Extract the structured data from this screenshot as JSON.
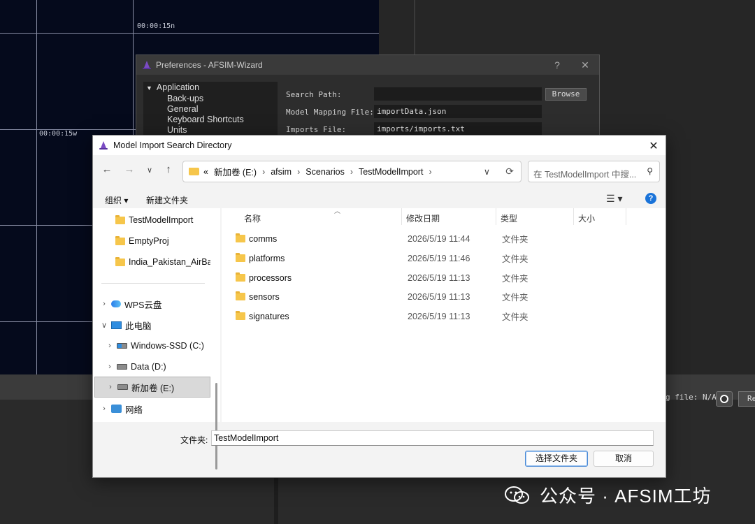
{
  "background": {
    "timestamps": [
      "00:00:15n",
      "00:00:15w"
    ],
    "log_label": "g file: N/A",
    "re_button": "Re"
  },
  "preferences": {
    "title": "Preferences - AFSIM-Wizard",
    "help": "?",
    "close": "✕",
    "tree": {
      "root": "Application",
      "children": [
        "Back-ups",
        "General",
        "Keyboard Shortcuts",
        "Units"
      ]
    },
    "fields": [
      {
        "label": "Search Path:",
        "value": ""
      },
      {
        "label": "Model Mapping File:",
        "value": "importData.json"
      },
      {
        "label": "Imports File:",
        "value": "imports/imports.txt"
      }
    ],
    "browse_label": "Browse"
  },
  "dialog": {
    "title": "Model Import Search Directory",
    "close": "✕",
    "address": {
      "prefix": "«",
      "segments": [
        "新加卷 (E:)",
        "afsim",
        "Scenarios",
        "TestModelImport"
      ]
    },
    "search_placeholder": "在 TestModelImport 中搜...",
    "toolbar": {
      "organize": "组织 ▾",
      "new_folder": "新建文件夹"
    },
    "nav": {
      "folders": [
        "TestModelImport",
        "EmptyProj",
        "India_Pakistan_AirBatt"
      ],
      "wps": "WPS云盘",
      "this_pc": "此电脑",
      "drives": [
        "Windows-SSD (C:)",
        "Data (D:)",
        "新加卷 (E:)"
      ],
      "network": "网络"
    },
    "columns": [
      "名称",
      "修改日期",
      "类型",
      "大小"
    ],
    "files": [
      {
        "name": "comms",
        "date": "2026/5/19 11:44",
        "type": "文件夹"
      },
      {
        "name": "platforms",
        "date": "2026/5/19 11:46",
        "type": "文件夹"
      },
      {
        "name": "processors",
        "date": "2026/5/19 11:13",
        "type": "文件夹"
      },
      {
        "name": "sensors",
        "date": "2026/5/19 11:13",
        "type": "文件夹"
      },
      {
        "name": "signatures",
        "date": "2026/5/19 11:13",
        "type": "文件夹"
      }
    ],
    "folder_label": "文件夹:",
    "folder_value": "TestModelImport",
    "select_button": "选择文件夹",
    "cancel_button": "取消"
  },
  "watermark": "公众号 · AFSIM工坊",
  "colors": {
    "folder": "#f6c64b",
    "accent": "#1a73d9",
    "map_bg": "#050a1c"
  }
}
